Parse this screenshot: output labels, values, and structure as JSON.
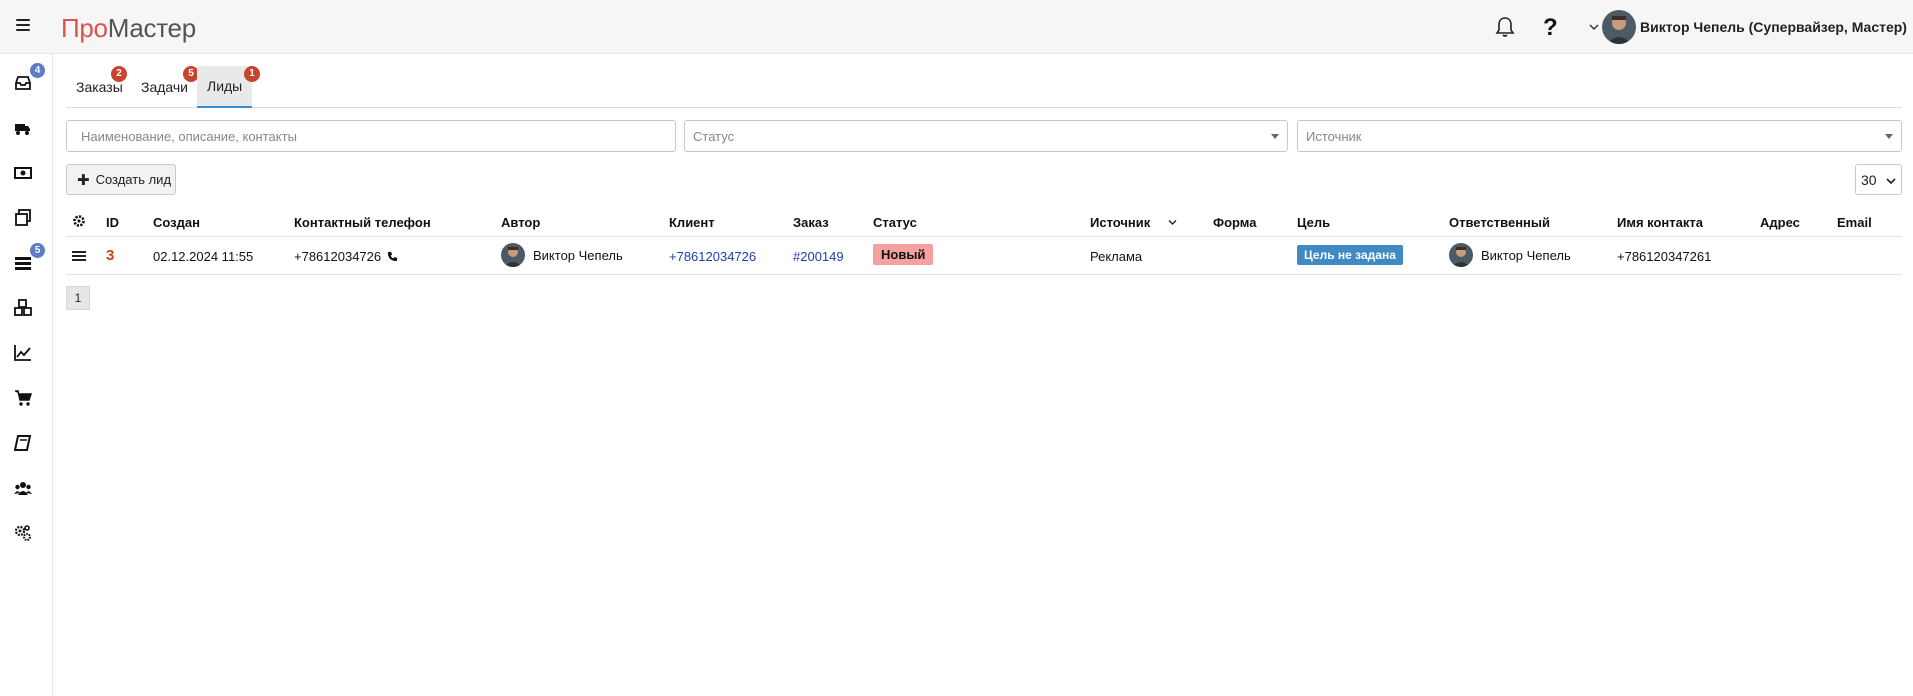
{
  "app": {
    "logo_part1": "Про",
    "logo_part2": "Мастер"
  },
  "header": {
    "help_label": "?",
    "user_name": "Виктор Чепель (Супервайзер, Мастер)"
  },
  "sidebar": {
    "items": [
      {
        "icon": "inbox-icon",
        "badge": "4"
      },
      {
        "icon": "truck-icon",
        "badge": ""
      },
      {
        "icon": "money-icon",
        "badge": ""
      },
      {
        "icon": "copy-icon",
        "badge": ""
      },
      {
        "icon": "list-icon",
        "badge": "5"
      },
      {
        "icon": "cubes-icon",
        "badge": ""
      },
      {
        "icon": "line-chart-icon",
        "badge": ""
      },
      {
        "icon": "cart-icon",
        "badge": ""
      },
      {
        "icon": "book-icon",
        "badge": ""
      },
      {
        "icon": "users-icon",
        "badge": ""
      },
      {
        "icon": "cogs-icon",
        "badge": ""
      }
    ]
  },
  "tabs": [
    {
      "label": "Заказы",
      "badge": "2",
      "active": false
    },
    {
      "label": "Задачи",
      "badge": "5",
      "active": false
    },
    {
      "label": "Лиды",
      "badge": "1",
      "active": true
    }
  ],
  "filters": {
    "search_placeholder": "Наименование, описание, контакты",
    "status_placeholder": "Статус",
    "source_placeholder": "Источник"
  },
  "toolbar": {
    "create_label": "Создать лид",
    "per_page": "30"
  },
  "table": {
    "columns": [
      "ID",
      "Создан",
      "Контактный телефон",
      "Автор",
      "Клиент",
      "Заказ",
      "Статус",
      "Источник",
      "Форма",
      "Цель",
      "Ответственный",
      "Имя контакта",
      "Адрес",
      "Email"
    ],
    "rows": [
      {
        "id": "3",
        "created": "02.12.2024 11:55",
        "phone": "+78612034726",
        "author": "Виктор Чепель",
        "client": "+78612034726",
        "order": "#200149",
        "status": "Новый",
        "source": "Реклама",
        "form": "",
        "goal": "Цель не задана",
        "responsible": "Виктор Чепель",
        "contact_name": "+786120347261",
        "address": "",
        "email": ""
      }
    ]
  },
  "pagination": {
    "current": "1"
  },
  "colors": {
    "accent": "#3d8bd5",
    "badge_red": "#c9442e",
    "status_new": "#f5a1a1",
    "goal_badge": "#3f89c4",
    "link": "#1f3fb0"
  }
}
